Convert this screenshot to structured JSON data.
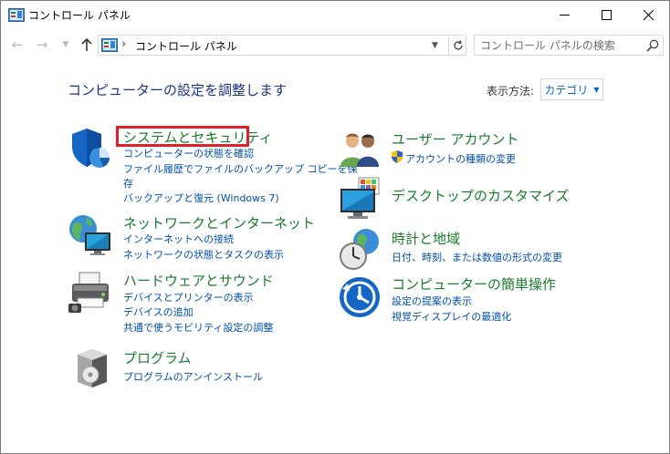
{
  "window": {
    "title": "コントロール パネル"
  },
  "address": {
    "crumb": "コントロール パネル",
    "search_placeholder": "コントロール パネルの検索"
  },
  "content": {
    "heading": "コンピューターの設定を調整します",
    "view_by_label": "表示方法:",
    "view_by_value": "カテゴリ"
  },
  "categories": {
    "system": {
      "title": "システムとセキュリティ",
      "links": [
        "コンピューターの状態を確認",
        "ファイル履歴でファイルのバックアップ コピーを保",
        "存",
        "バックアップと復元 (Windows 7)"
      ]
    },
    "network": {
      "title": "ネットワークとインターネット",
      "links": [
        "インターネットへの接続",
        "ネットワークの状態とタスクの表示"
      ]
    },
    "hardware": {
      "title": "ハードウェアとサウンド",
      "links": [
        "デバイスとプリンターの表示",
        "デバイスの追加",
        "共通で使うモビリティ設定の調整"
      ]
    },
    "programs": {
      "title": "プログラム",
      "links": [
        "プログラムのアンインストール"
      ]
    },
    "users": {
      "title": "ユーザー アカウント",
      "links": [
        "アカウントの種類の変更"
      ]
    },
    "desktop": {
      "title": "デスクトップのカスタマイズ",
      "links": []
    },
    "clock": {
      "title": "時計と地域",
      "links": [
        "日付、時刻、または数値の形式の変更"
      ]
    },
    "ease": {
      "title": "コンピューターの簡単操作",
      "links": [
        "設定の提案の表示",
        "視覚ディスプレイの最適化"
      ]
    }
  },
  "colors": {
    "category_title": "#1a7a2c",
    "link": "#0050a8",
    "heading": "#1e3287",
    "highlight": "#e01f26"
  }
}
